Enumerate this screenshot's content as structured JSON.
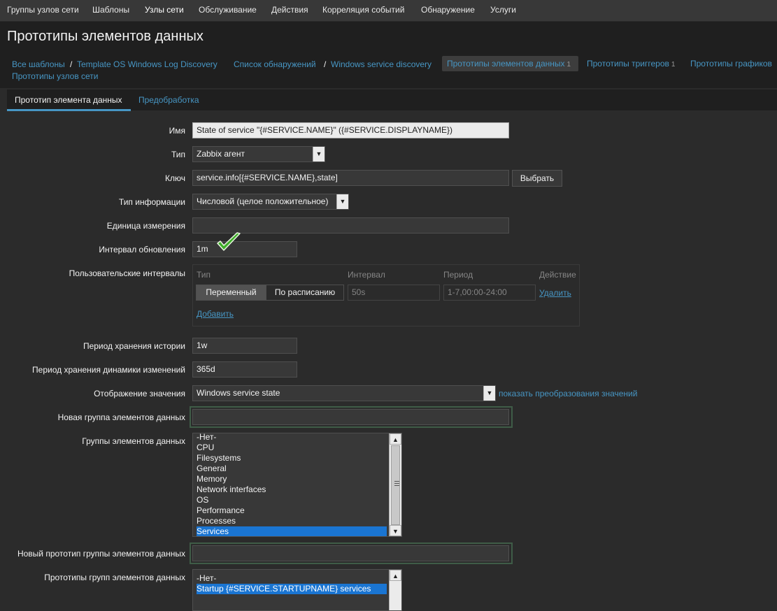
{
  "topnav": [
    "Группы узлов сети",
    "Шаблоны",
    "Узлы сети",
    "Обслуживание",
    "Действия",
    "Корреляция событий",
    "Обнаружение",
    "Услуги"
  ],
  "page_title": "Прототипы элементов данных",
  "breadcrumbs": {
    "all_templates": "Все шаблоны",
    "template": "Template OS Windows Log Discovery",
    "discovery_list": "Список обнаружений",
    "discovery_rule": "Windows service discovery",
    "item_prototypes": "Прототипы элементов данных",
    "item_prototypes_count": "1",
    "trigger_prototypes": "Прототипы триггеров",
    "trigger_prototypes_count": "1",
    "graph_prototypes": "Прототипы графиков",
    "host_prototypes": "Прототипы узлов сети",
    "separator": "/"
  },
  "tabs": [
    "Прототип элемента данных",
    "Предобработка"
  ],
  "form": {
    "name_label": "Имя",
    "name_value": "State of service \"{#SERVICE.NAME}\" ({#SERVICE.DISPLAYNAME})",
    "type_label": "Тип",
    "type_value": "Zabbix агент",
    "key_label": "Ключ",
    "key_value": "service.info[{#SERVICE.NAME},state]",
    "select_button": "Выбрать",
    "info_type_label": "Тип информации",
    "info_type_value": "Числовой (целое положительное)",
    "units_label": "Единица измерения",
    "units_value": "",
    "interval_label": "Интервал обновления",
    "interval_value": "1m",
    "custom_intervals_label": "Пользовательские интервалы",
    "custom_intervals": {
      "col_type": "Тип",
      "col_interval": "Интервал",
      "col_period": "Период",
      "col_action": "Действие",
      "opt_flexible": "Переменный",
      "opt_scheduling": "По расписанию",
      "interval_value": "50s",
      "period_value": "1-7,00:00-24:00",
      "remove": "Удалить",
      "add": "Добавить"
    },
    "history_label": "Период хранения истории",
    "history_value": "1w",
    "trends_label": "Период хранения динамики изменений",
    "trends_value": "365d",
    "valuemap_label": "Отображение значения",
    "valuemap_value": "Windows service state",
    "valuemap_link": "показать преобразования значений",
    "new_app_label": "Новая группа элементов данных",
    "new_app_value": "",
    "apps_label": "Группы элементов данных",
    "apps": [
      "-Нет-",
      "CPU",
      "Filesystems",
      "General",
      "Memory",
      "Network interfaces",
      "OS",
      "Performance",
      "Processes",
      "Services"
    ],
    "apps_selected": "Services",
    "new_app_proto_label": "Новый прототип группы элементов данных",
    "new_app_proto_value": "",
    "app_protos_label": "Прототипы групп элементов данных",
    "app_protos": [
      "-Нет-",
      "Startup {#SERVICE.STARTUPNAME} services"
    ],
    "app_protos_selected": "Startup {#SERVICE.STARTUPNAME} services"
  },
  "colors": {
    "accent_link": "#4796c4",
    "selection": "#1a75d2",
    "check": "#3fae2a"
  }
}
